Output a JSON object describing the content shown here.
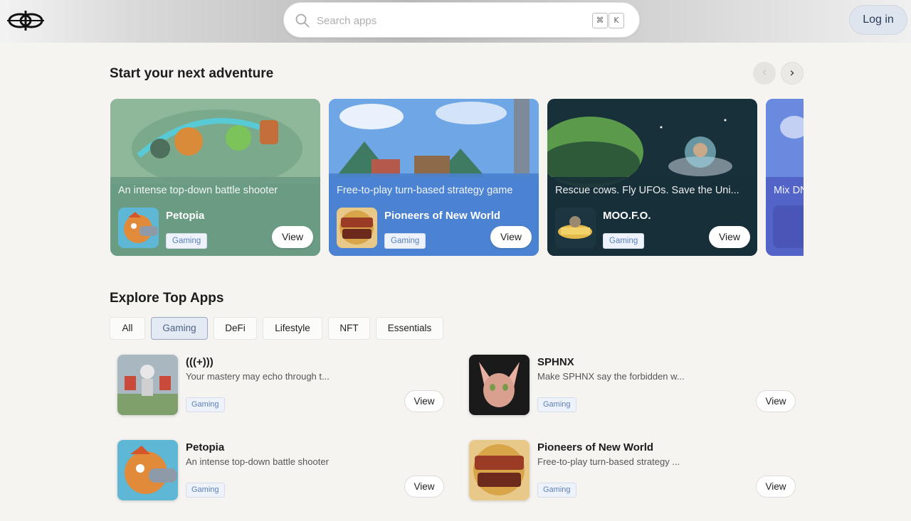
{
  "header": {
    "search": {
      "placeholder": "Search apps",
      "shortcut_keys": [
        "⌘",
        "K"
      ]
    },
    "login_label": "Log in"
  },
  "featured": {
    "title": "Start your next adventure",
    "prev_icon": "chevron-left-icon",
    "next_icon": "chevron-right-icon",
    "cards": [
      {
        "tagline": "An intense top-down battle shooter",
        "name": "Petopia",
        "category": "Gaming",
        "view_label": "View",
        "bg_color": "#6e9f86"
      },
      {
        "tagline": "Free-to-play turn-based strategy game",
        "name": "Pioneers of New World",
        "category": "Gaming",
        "view_label": "View",
        "bg_color": "#4f86d3"
      },
      {
        "tagline": "Rescue cows. Fly UFOs. Save the Uni...",
        "name": "MOO.F.O.",
        "category": "Gaming",
        "view_label": "View",
        "bg_color": "#19303a"
      },
      {
        "tagline": "Mix DN",
        "name": "",
        "category": "",
        "view_label": "",
        "bg_color": "#5364c9"
      }
    ]
  },
  "explore": {
    "title": "Explore Top Apps",
    "filters": [
      {
        "label": "All",
        "active": false
      },
      {
        "label": "Gaming",
        "active": true
      },
      {
        "label": "DeFi",
        "active": false
      },
      {
        "label": "Lifestyle",
        "active": false
      },
      {
        "label": "NFT",
        "active": false
      },
      {
        "label": "Essentials",
        "active": false
      }
    ],
    "apps": [
      {
        "name": "(((+)))",
        "description": "Your mastery may echo through t...",
        "category": "Gaming",
        "view_label": "View"
      },
      {
        "name": "SPHNX",
        "description": "Make SPHNX say the forbidden w...",
        "category": "Gaming",
        "view_label": "View"
      },
      {
        "name": "Petopia",
        "description": "An intense top-down battle shooter",
        "category": "Gaming",
        "view_label": "View"
      },
      {
        "name": "Pioneers of New World",
        "description": "Free-to-play turn-based strategy ...",
        "category": "Gaming",
        "view_label": "View"
      }
    ]
  },
  "colors": {
    "background": "#f6f4f1",
    "badge_text": "#5b7fb8",
    "active_filter_bg": "#e4eaf3"
  }
}
